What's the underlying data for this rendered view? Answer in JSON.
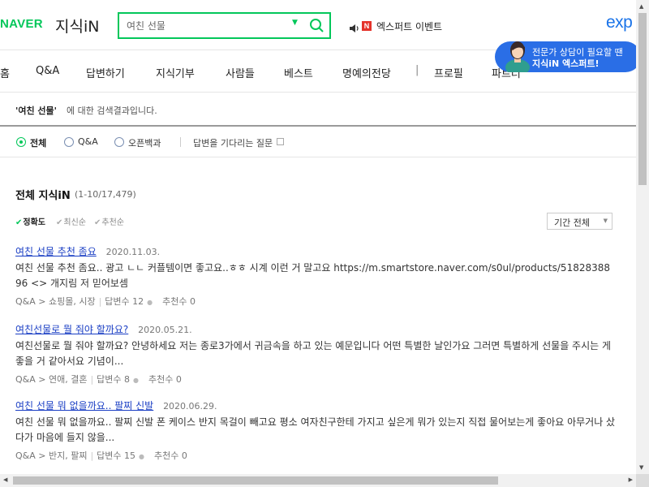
{
  "header": {
    "brand": "NAVER",
    "service": "지식iN",
    "search_placeholder": "여친 선물",
    "event_badge": "N",
    "event_label": "엑스퍼트 이벤트",
    "expert_logo": "exp"
  },
  "nav": {
    "items": [
      "홈",
      "Q&A",
      "답변하기",
      "지식기부",
      "사람들",
      "베스트",
      "명예의전당",
      "프로필"
    ],
    "cut_item": "파트너"
  },
  "banner": {
    "line1": "전문가 상담이 필요할 땐",
    "line2": "지식iN 엑스퍼트!"
  },
  "result_info": {
    "query": "'여친 선물'",
    "suffix": "에 대한 검색결과입니다."
  },
  "filters": {
    "options": [
      "전체",
      "Q&A",
      "오픈백과"
    ],
    "selected": "전체",
    "waiting_label": "답변을 기다리는 질문"
  },
  "section": {
    "title": "전체 지식iN",
    "count": "(1-10/17,479)"
  },
  "sort_options": [
    {
      "label": "정확도",
      "active": true
    },
    {
      "label": "최신순",
      "active": false
    },
    {
      "label": "추천순",
      "active": false
    }
  ],
  "period": {
    "label": "기간 전체"
  },
  "results": [
    {
      "title": "여친 선물 추천 좀요",
      "date": "2020.11.03.",
      "snippet": "여친 선물 추천 좀요.. 광고 ㄴㄴ 커플템이면 좋고요..ㅎㅎ 시계 이런 거 말고요 https://m.smartstore.naver.com/s0ul/products/5182838896 <> 개지림 저 믿어보셈",
      "category": "Q&A > 쇼핑몰, 시장",
      "answers": "답변수 12",
      "recommends": "추천수 0"
    },
    {
      "title": "여친선물로 뭘 줘야 할까요?",
      "date": "2020.05.21.",
      "snippet": "여친선물로 뭘 줘야 할까요? 안녕하세요 저는 종로3가에서 귀금속을 하고 있는 예문입니다 어떤 특별한 날인가요 그러면 특별하게 선물을 주시는 게 좋을 거 같아서요 기념이...",
      "category": "Q&A > 연애, 결혼",
      "answers": "답변수 8",
      "recommends": "추천수 0"
    },
    {
      "title": "여친 선물 뭐 없을까요.. 팔찌 신발",
      "date": "2020.06.29.",
      "snippet": "여친 선물 뭐 없을까요.. 팔찌 신발 폰 케이스 반지 목걸이 빼고요 평소 여자친구한테 가지고 싶은게 뭐가 있는지 직접 물어보는게 좋아요 아무거나 샀다가 마음에 들지 않을...",
      "category": "Q&A > 반지, 팔찌",
      "answers": "답변수 15",
      "recommends": "추천수 0"
    }
  ],
  "colors": {
    "brand_green": "#03c75a",
    "link_blue": "#1a3ec4",
    "expert_blue": "#2a6ee6"
  }
}
